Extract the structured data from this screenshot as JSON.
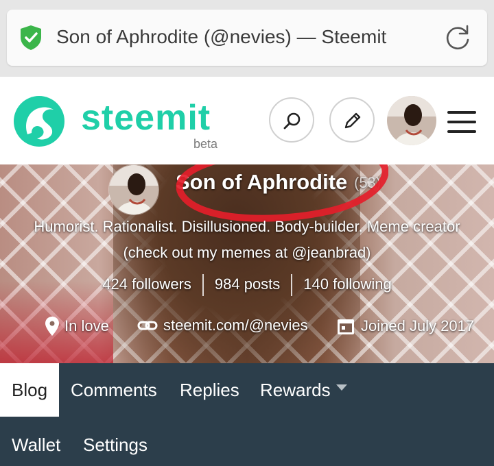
{
  "browser": {
    "page_title": "Son of Aphrodite (@nevies) — Steemit",
    "icons": {
      "secure": "shield-check-icon",
      "reload": "reload-icon"
    }
  },
  "header": {
    "logo_text": "steemit",
    "beta_label": "beta",
    "brand_color": "#1fcfa8",
    "icons": [
      "search-icon",
      "pencil-icon",
      "menu-icon"
    ]
  },
  "profile": {
    "name": "Son of Aphrodite",
    "reputation": "(53)",
    "about": "Humorist. Rationalist. Disillusioned. Body-builder. Meme creator (check out my memes at @jeanbrad)",
    "followers": "424 followers",
    "posts": "984 posts",
    "following": "140 following",
    "location": "In love",
    "website": "steemit.com/@nevies",
    "joined": "Joined July 2017"
  },
  "tabs": {
    "blog": "Blog",
    "comments": "Comments",
    "replies": "Replies",
    "rewards": "Rewards",
    "wallet": "Wallet",
    "settings": "Settings",
    "active": "Blog"
  },
  "colors": {
    "tab_bar": "#2c3e4b",
    "annotation_circle": "#e41e2a"
  }
}
